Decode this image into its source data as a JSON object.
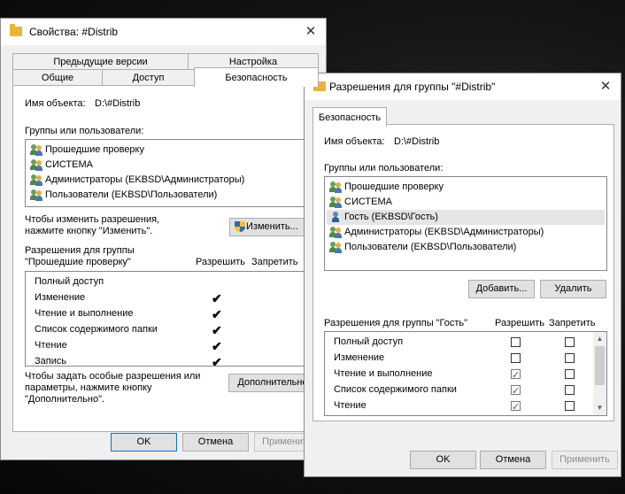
{
  "props": {
    "title": "Свойства: #Distrib",
    "tabs_row1": [
      "Предыдущие версии",
      "Настройка"
    ],
    "tabs_row2": [
      "Общие",
      "Доступ",
      "Безопасность"
    ],
    "object_label": "Имя объекта:",
    "object_value": "D:\\#Distrib",
    "groups_label": "Группы или пользователи:",
    "users": [
      "Прошедшие проверку",
      "СИСТЕМА",
      "Администраторы (EKBSD\\Администраторы)",
      "Пользователи (EKBSD\\Пользователи)"
    ],
    "change_hint_1": "Чтобы изменить разрешения,",
    "change_hint_2": "нажмите кнопку \"Изменить\".",
    "change_button": "Изменить...",
    "perm_title_1": "Разрешения для группы",
    "perm_title_2": "\"Прошедшие проверку\"",
    "allow_header": "Разрешить",
    "deny_header": "Запретить",
    "permissions": [
      "Полный доступ",
      "Изменение",
      "Чтение и выполнение",
      "Список содержимого папки",
      "Чтение",
      "Запись"
    ],
    "allow_checked": [
      false,
      true,
      true,
      true,
      true,
      true
    ],
    "special_hint_1": "Чтобы задать особые разрешения или",
    "special_hint_2": "параметры, нажмите кнопку",
    "special_hint_3": "\"Дополнительно\".",
    "advanced_button": "Дополнительно",
    "ok": "OK",
    "cancel": "Отмена",
    "apply": "Применить"
  },
  "perm": {
    "title": "Разрешения для группы \"#Distrib\"",
    "tab": "Безопасность",
    "object_label": "Имя объекта:",
    "object_value": "D:\\#Distrib",
    "groups_label": "Группы или пользователи:",
    "users": [
      "Прошедшие проверку",
      "СИСТЕМА",
      "Гость (EKBSD\\Гость)",
      "Администраторы (EKBSD\\Администраторы)",
      "Пользователи (EKBSD\\Пользователи)"
    ],
    "selected_user_index": 2,
    "add_button": "Добавить...",
    "remove_button": "Удалить",
    "perm_title": "Разрешения для группы \"Гость\"",
    "allow_header": "Разрешить",
    "deny_header": "Запретить",
    "permissions": [
      "Полный доступ",
      "Изменение",
      "Чтение и выполнение",
      "Список содержимого папки",
      "Чтение"
    ],
    "allow_checked": [
      false,
      false,
      true,
      true,
      true
    ],
    "deny_checked": [
      false,
      false,
      false,
      false,
      false
    ],
    "ok": "OK",
    "cancel": "Отмена",
    "apply": "Применить"
  }
}
